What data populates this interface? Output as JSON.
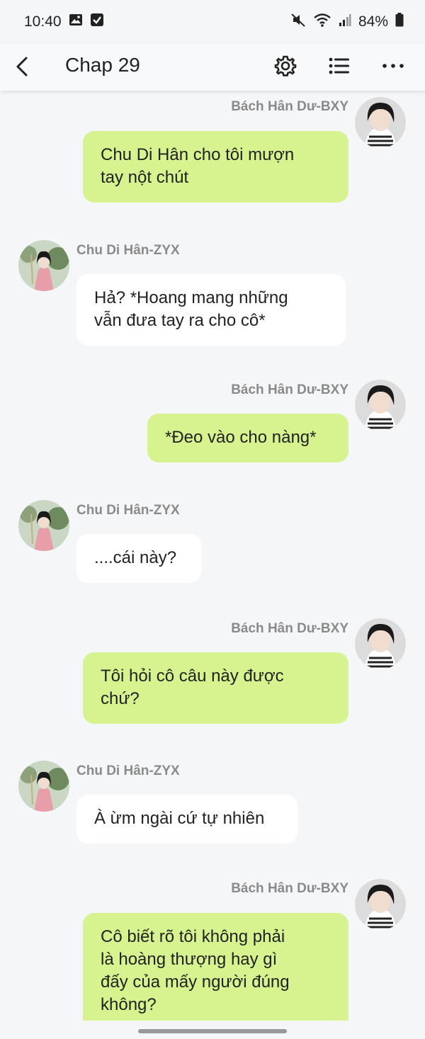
{
  "status_bar": {
    "time": "10:40",
    "battery": "84%"
  },
  "app_bar": {
    "title": "Chap 29"
  },
  "icons": {
    "back": "back-arrow-icon",
    "settings": "gear-icon",
    "list": "list-icon",
    "more": "more-horizontal-icon"
  },
  "colors": {
    "background": "#f5f6f8",
    "bubble_right": "#d7f38f",
    "bubble_left": "#ffffff",
    "name_text": "#8a8a8a"
  },
  "messages": [
    {
      "side": "right",
      "name": "Bách Hân Dư-BXY",
      "text": "Chu Di Hân cho tôi mượn\ntay nột chút"
    },
    {
      "side": "left",
      "name": "Chu Di Hân-ZYX",
      "text": "Hả? *Hoang mang những\nvẫn đưa tay ra cho cô*"
    },
    {
      "side": "right",
      "name": "Bách Hân Dư-BXY",
      "text": "*Đeo vào cho nàng*"
    },
    {
      "side": "left",
      "name": "Chu Di Hân-ZYX",
      "text": "....cái này?"
    },
    {
      "side": "right",
      "name": "Bách Hân Dư-BXY",
      "text": "Tôi hỏi cô câu này được\nchứ?"
    },
    {
      "side": "left",
      "name": "Chu Di Hân-ZYX",
      "text": "À ừm ngài cứ tự nhiên"
    },
    {
      "side": "right",
      "name": "Bách Hân Dư-BXY",
      "text": "Cô biết rõ tôi không phải\nlà hoàng thượng hay gì\nđấy của mấy người đúng\nkhông?"
    }
  ]
}
